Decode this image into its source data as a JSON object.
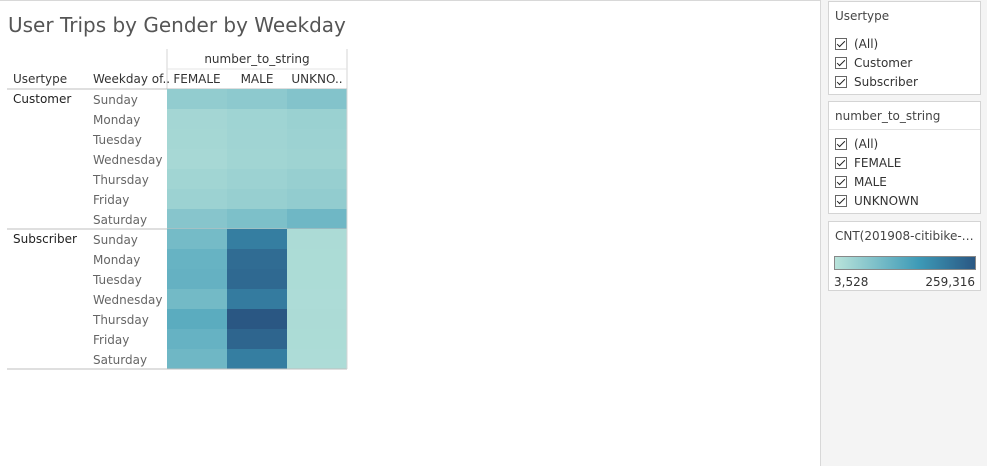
{
  "title": "User Trips by Gender by Weekday",
  "chart_data": {
    "type": "heatmap",
    "column_field_label": "number_to_string",
    "row_header_labels": [
      "Usertype",
      "Weekday of.."
    ],
    "columns": [
      "FEMALE",
      "MALE",
      "UNKNO.."
    ],
    "groups": [
      {
        "name": "Customer",
        "rows": [
          {
            "weekday": "Sunday",
            "values": [
              52000,
              58000,
              70000
            ]
          },
          {
            "weekday": "Monday",
            "values": [
              30000,
              36000,
              42000
            ]
          },
          {
            "weekday": "Tuesday",
            "values": [
              28000,
              35000,
              40000
            ]
          },
          {
            "weekday": "Wednesday",
            "values": [
              26000,
              33000,
              37000
            ]
          },
          {
            "weekday": "Thursday",
            "values": [
              33000,
              40000,
              46000
            ]
          },
          {
            "weekday": "Friday",
            "values": [
              40000,
              46000,
              52000
            ]
          },
          {
            "weekday": "Saturday",
            "values": [
              66000,
              78000,
              95000
            ]
          }
        ]
      },
      {
        "name": "Subscriber",
        "rows": [
          {
            "weekday": "Sunday",
            "values": [
              88000,
              200000,
              20000
            ]
          },
          {
            "weekday": "Monday",
            "values": [
              105000,
              228000,
              19000
            ]
          },
          {
            "weekday": "Tuesday",
            "values": [
              108000,
              232000,
              19000
            ]
          },
          {
            "weekday": "Wednesday",
            "values": [
              90000,
              205000,
              18000
            ]
          },
          {
            "weekday": "Thursday",
            "values": [
              120000,
              259316,
              20000
            ]
          },
          {
            "weekday": "Friday",
            "values": [
              106000,
              238000,
              19000
            ]
          },
          {
            "weekday": "Saturday",
            "values": [
              95000,
              200000,
              18000
            ]
          }
        ]
      }
    ],
    "color_min": 3528,
    "color_max": 259316,
    "color_low": "#b9e3da",
    "color_mid": "#3d9ab7",
    "color_high": "#2a5783"
  },
  "filters": [
    {
      "title": "Usertype",
      "items": [
        "(All)",
        "Customer",
        "Subscriber"
      ]
    },
    {
      "title": "number_to_string",
      "items": [
        "(All)",
        "FEMALE",
        "MALE",
        "UNKNOWN"
      ]
    }
  ],
  "color_legend": {
    "title": "CNT(201908-citibike-tr...",
    "min_label": "3,528",
    "max_label": "259,316"
  }
}
